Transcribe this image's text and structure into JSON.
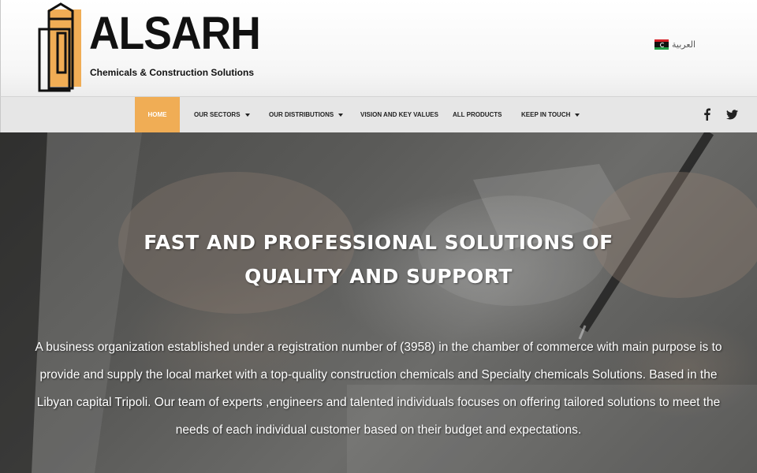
{
  "brand": {
    "name": "ALSARH",
    "tagline": "Chemicals & Construction Solutions",
    "colors": {
      "accent": "#f0ad55",
      "dark": "#111111"
    }
  },
  "language": {
    "label": "العربية",
    "flag_icon": "libya-flag-icon"
  },
  "nav": {
    "items": [
      {
        "label": "HOME",
        "active": true
      },
      {
        "label": "OUR SECTORS",
        "dropdown": true
      },
      {
        "label": "OUR DISTRIBUTIONS",
        "dropdown": true
      },
      {
        "label": "VISION AND KEY VALUES"
      },
      {
        "label": "ALL PRODUCTS"
      },
      {
        "label": "KEEP IN TOUCH",
        "dropdown": true
      }
    ],
    "social": [
      {
        "icon": "facebook-icon"
      },
      {
        "icon": "twitter-icon"
      }
    ]
  },
  "hero": {
    "title": "FAST AND PROFESSIONAL SOLUTIONS OF QUALITY AND SUPPORT",
    "text": "A business organization established under a registration number of (3958) in the chamber of commerce with main purpose is to provide and supply the local market with a top-quality construction chemicals and Specialty chemicals Solutions. Based in the Libyan capital Tripoli. Our team of experts ,engineers and talented individuals focuses on offering tailored solutions to meet the needs of each individual customer based on their budget and expectations."
  }
}
